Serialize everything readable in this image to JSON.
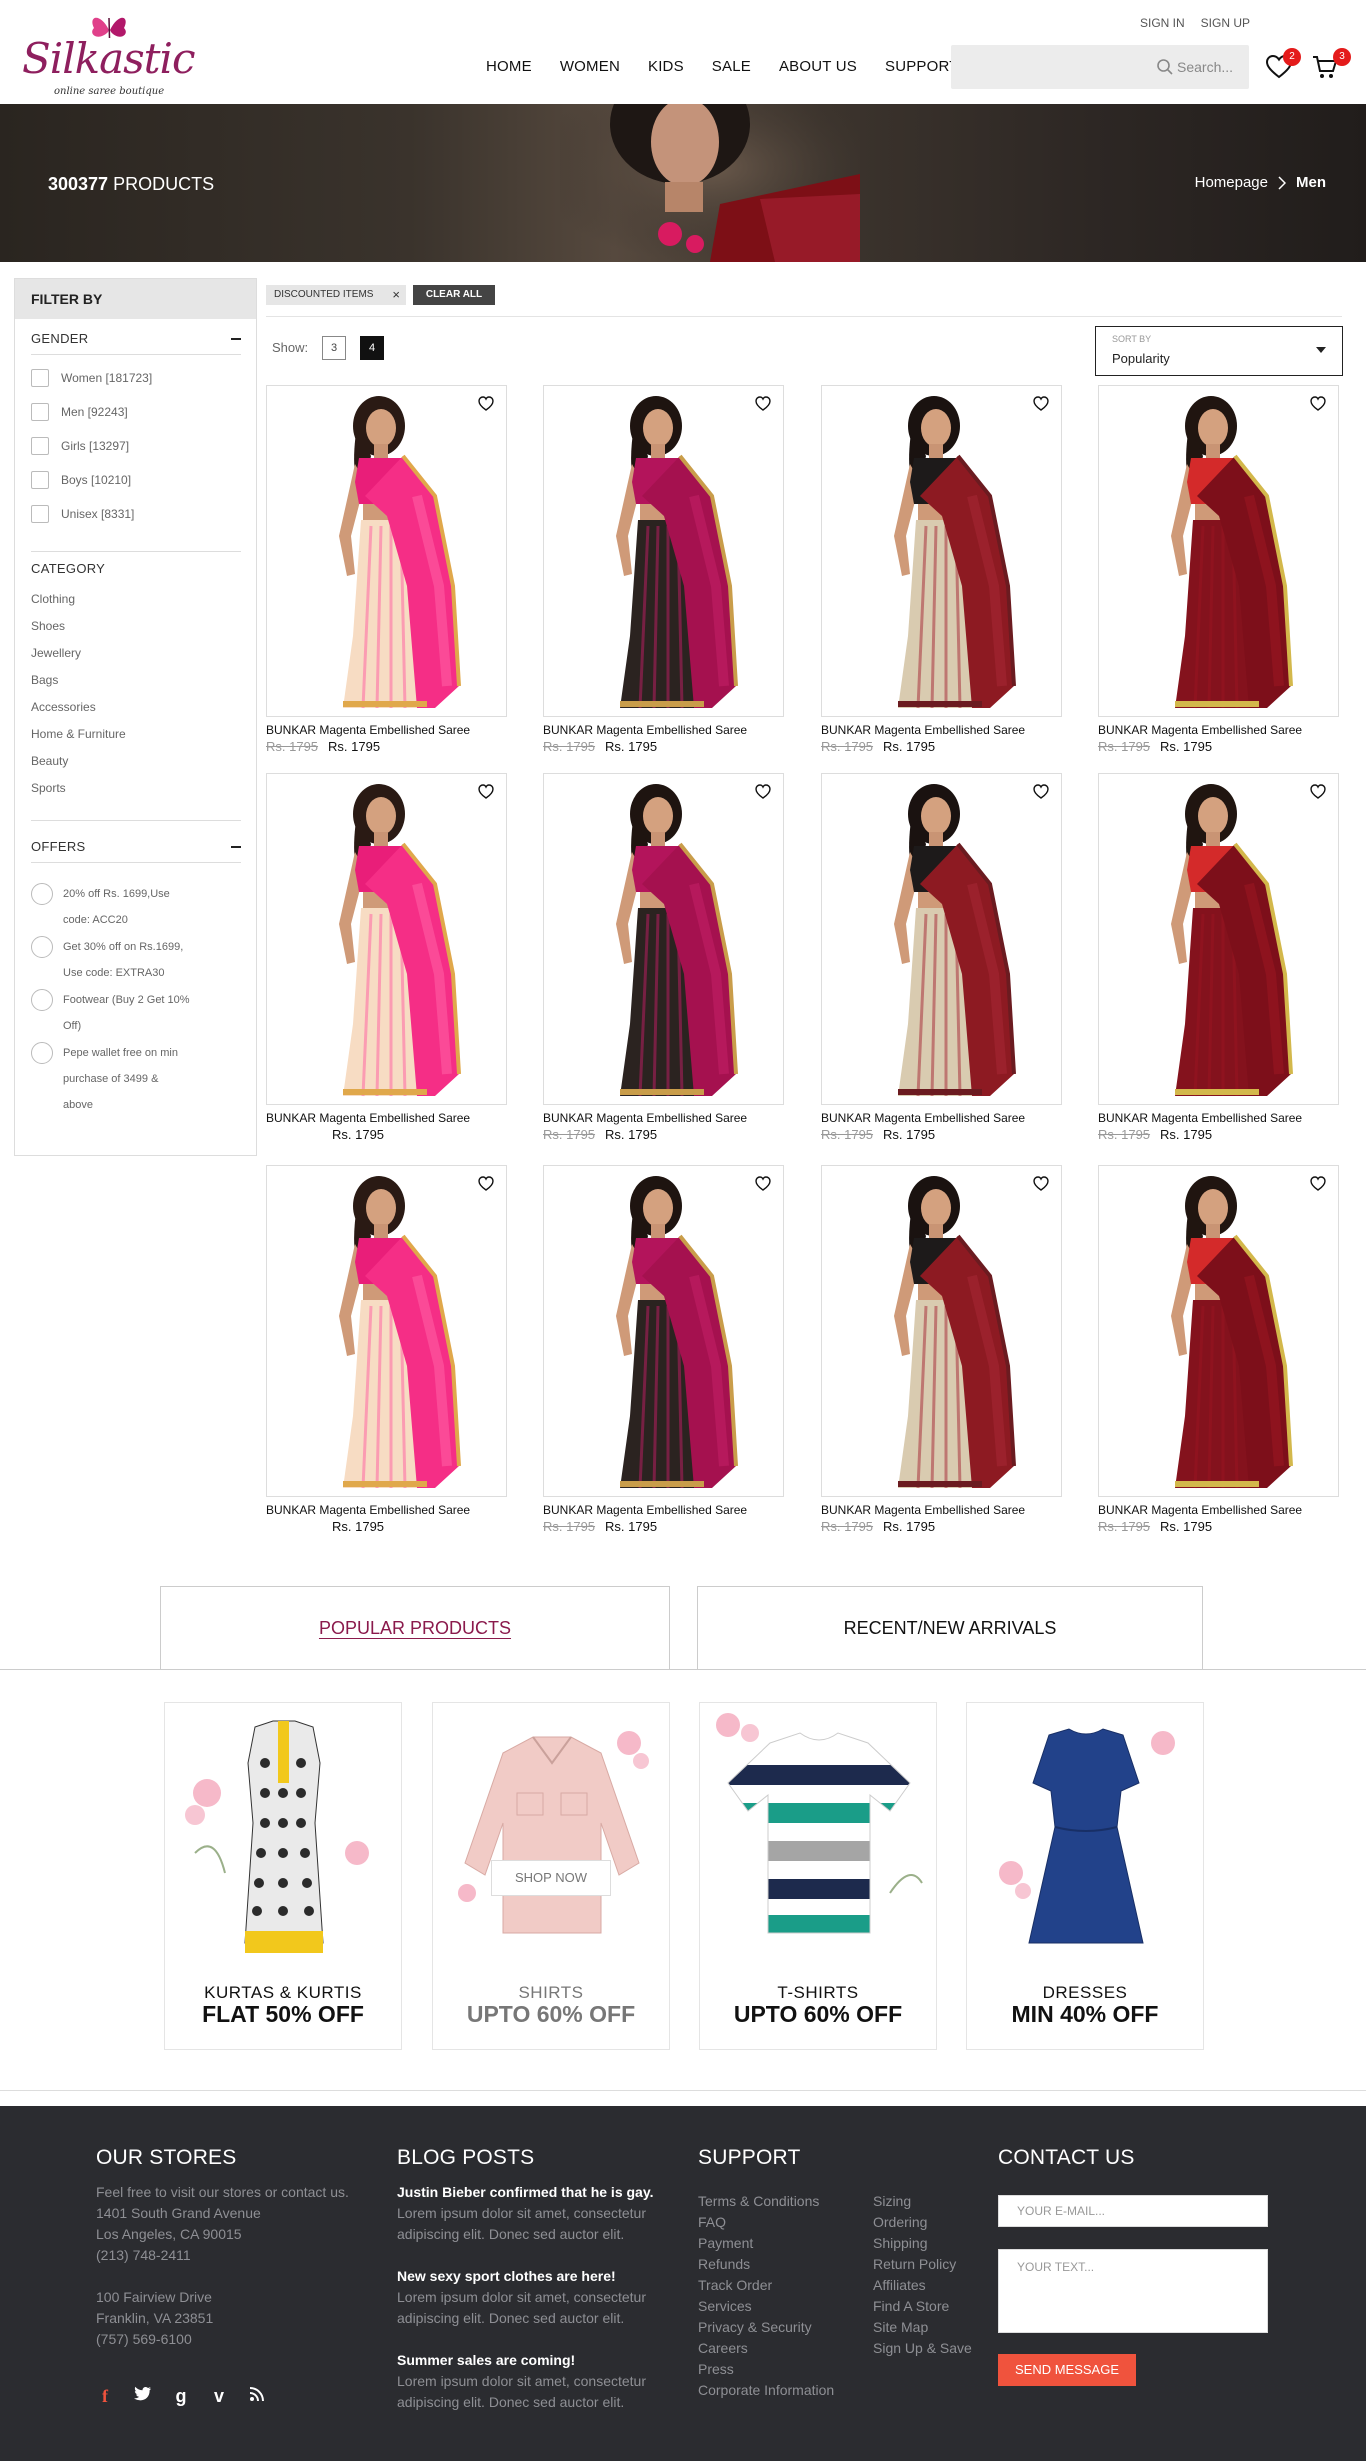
{
  "header": {
    "logo_text": "Silkastic",
    "logo_tagline": "online saree boutique",
    "sign_in": "SIGN IN",
    "sign_up": "SIGN UP",
    "nav": [
      "HOME",
      "WOMEN",
      "KIDS",
      "SALE",
      "ABOUT US",
      "SUPPORT"
    ],
    "search_placeholder": "Search...",
    "wishlist_count": "2",
    "cart_count": "3"
  },
  "banner": {
    "count_bold": "300377",
    "count_label": "PRODUCTS",
    "breadcrumb_home": "Homepage",
    "breadcrumb_current": "Men"
  },
  "sidebar": {
    "title": "FILTER BY",
    "gender_title": "GENDER",
    "gender": [
      "Women [181723]",
      "Men [92243]",
      "Girls [13297]",
      "Boys [10210]",
      "Unisex [8331]"
    ],
    "category_title": "CATEGORY",
    "categories": [
      "Clothing",
      "Shoes",
      "Jewellery",
      "Bags",
      "Accessories",
      "Home & Furniture",
      "Beauty",
      "Sports"
    ],
    "offers_title": "OFFERS",
    "offers": [
      [
        "20% off Rs. 1699,Use",
        "code: ACC20"
      ],
      [
        "Get 30% off on Rs.1699,",
        "Use code: EXTRA30"
      ],
      [
        "Footwear (Buy 2 Get 10%",
        "Off)"
      ],
      [
        "Pepe wallet free on min",
        "purchase of 3499 &",
        "above"
      ]
    ]
  },
  "toolbar": {
    "chip_label": "DISCOUNTED ITEMS",
    "clear_all": "CLEAR ALL",
    "show_label": "Show:",
    "show_options": [
      "3",
      "4"
    ],
    "sort_label": "SORT BY",
    "sort_value": "Popularity"
  },
  "products": [
    {
      "name": "BUNKAR Magenta Embellished Saree",
      "old": "Rs. 1795",
      "price": "Rs. 1795",
      "style": "pink"
    },
    {
      "name": "BUNKAR Magenta Embellished Saree",
      "old": "Rs. 1795",
      "price": "Rs. 1795",
      "style": "black"
    },
    {
      "name": "BUNKAR Magenta Embellished Saree",
      "old": "Rs. 1795",
      "price": "Rs. 1795",
      "style": "beige"
    },
    {
      "name": "BUNKAR Magenta Embellished Saree",
      "old": "Rs. 1795",
      "price": "Rs. 1795",
      "style": "red"
    },
    {
      "name": "BUNKAR Magenta Embellished Saree",
      "old": "",
      "price": "Rs. 1795",
      "style": "pink"
    },
    {
      "name": "BUNKAR Magenta Embellished Saree",
      "old": "Rs. 1795",
      "price": "Rs. 1795",
      "style": "black"
    },
    {
      "name": "BUNKAR Magenta Embellished Saree",
      "old": "Rs. 1795",
      "price": "Rs. 1795",
      "style": "beige"
    },
    {
      "name": "BUNKAR Magenta Embellished Saree",
      "old": "Rs. 1795",
      "price": "Rs. 1795",
      "style": "red"
    },
    {
      "name": "BUNKAR Magenta Embellished Saree",
      "old": "",
      "price": "Rs. 1795",
      "style": "pink"
    },
    {
      "name": "BUNKAR Magenta Embellished Saree",
      "old": "Rs. 1795",
      "price": "Rs. 1795",
      "style": "black"
    },
    {
      "name": "BUNKAR Magenta Embellished Saree",
      "old": "Rs. 1795",
      "price": "Rs. 1795",
      "style": "beige"
    },
    {
      "name": "BUNKAR Magenta Embellished Saree",
      "old": "Rs. 1795",
      "price": "Rs. 1795",
      "style": "red"
    }
  ],
  "tabs": {
    "popular": "POPULAR PRODUCTS",
    "recent": "RECENT/NEW ARRIVALS"
  },
  "promos": [
    {
      "line1": "KURTAS & KURTIS",
      "line2": "FLAT 50% OFF",
      "item": "kurta-icon"
    },
    {
      "line1": "SHIRTS",
      "line2": "UPTO 60% OFF",
      "item": "shirt-icon",
      "button": "SHOP NOW"
    },
    {
      "line1": "T-SHIRTS",
      "line2": "UPTO 60% OFF",
      "item": "tshirt-icon"
    },
    {
      "line1": "DRESSES",
      "line2": "MIN 40% OFF",
      "item": "dress-icon"
    }
  ],
  "footer": {
    "stores_title": "OUR STORES",
    "stores_lines": [
      "Feel free to visit our stores or contact us.",
      "1401 South Grand Avenue",
      "Los Angeles, CA 90015",
      "(213) 748-2411",
      "",
      "100 Fairview Drive",
      "Franklin, VA 23851",
      "(757) 569-6100"
    ],
    "blog_title": "BLOG POSTS",
    "blog": [
      {
        "title": "Justin Bieber confirmed that he is gay.",
        "text1": "Lorem ipsum dolor sit amet, consectetur",
        "text2": "adipiscing elit. Donec sed auctor elit."
      },
      {
        "title": "New sexy sport clothes are here!",
        "text1": "Lorem ipsum dolor sit amet, consectetur",
        "text2": "adipiscing elit. Donec sed auctor elit."
      },
      {
        "title": "Summer sales are coming!",
        "text1": "Lorem ipsum dolor sit amet, consectetur",
        "text2": "adipiscing elit. Donec sed auctor elit."
      }
    ],
    "support_title": "SUPPORT",
    "support_col1": [
      "Terms & Conditions",
      "FAQ",
      "Payment",
      "Refunds",
      "Track Order",
      "Services",
      "Privacy & Security",
      "Careers",
      "Press",
      "Corporate Information"
    ],
    "support_col2": [
      "Sizing",
      "Ordering",
      "Shipping",
      "Return Policy",
      "Affiliates",
      "Find A Store",
      "Site Map",
      "Sign Up & Save"
    ],
    "contact_title": "CONTACT US",
    "email_placeholder": "YOUR E-MAIL...",
    "text_placeholder": "YOUR TEXT...",
    "send": "SEND MESSAGE",
    "social": [
      "facebook-icon",
      "twitter-icon",
      "google-plus-icon",
      "vimeo-icon",
      "rss-icon"
    ]
  },
  "colors": {
    "brand": "#8e1f5e",
    "badge": "#e41b1b",
    "footer_bg": "#2b2c30",
    "send_button": "#f0533d"
  }
}
